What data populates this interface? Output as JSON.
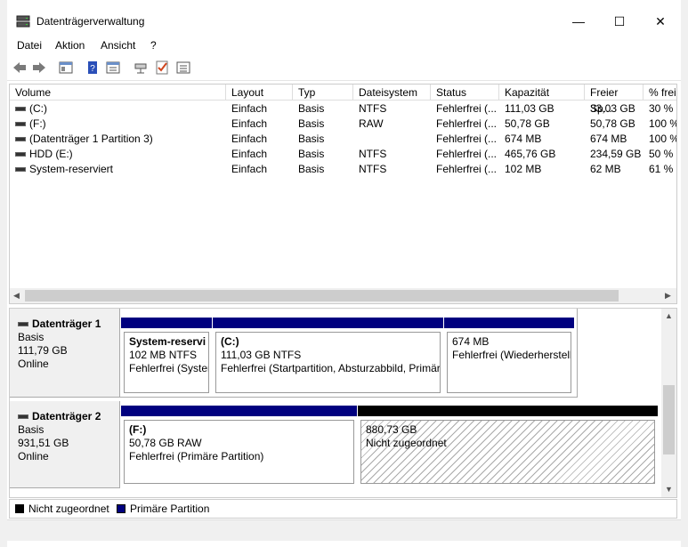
{
  "window": {
    "title": "Datenträgerverwaltung",
    "minimize": "—",
    "maximize": "☐",
    "close": "✕"
  },
  "menu": [
    "Datei",
    "Aktion",
    "Ansicht",
    "?"
  ],
  "table": {
    "columns": [
      "Volume",
      "Layout",
      "Typ",
      "Dateisystem",
      "Status",
      "Kapazität",
      "Freier Sp...",
      "% frei"
    ],
    "rows": [
      {
        "volume": "(C:)",
        "layout": "Einfach",
        "typ": "Basis",
        "fs": "NTFS",
        "status": "Fehlerfrei (...",
        "cap": "111,03 GB",
        "free": "33,03 GB",
        "pct": "30 %"
      },
      {
        "volume": "(F:)",
        "layout": "Einfach",
        "typ": "Basis",
        "fs": "RAW",
        "status": "Fehlerfrei (...",
        "cap": "50,78 GB",
        "free": "50,78 GB",
        "pct": "100 %"
      },
      {
        "volume": "(Datenträger 1 Partition 3)",
        "layout": "Einfach",
        "typ": "Basis",
        "fs": "",
        "status": "Fehlerfrei (...",
        "cap": "674 MB",
        "free": "674 MB",
        "pct": "100 %"
      },
      {
        "volume": "HDD (E:)",
        "layout": "Einfach",
        "typ": "Basis",
        "fs": "NTFS",
        "status": "Fehlerfrei (...",
        "cap": "465,76 GB",
        "free": "234,59 GB",
        "pct": "50 %"
      },
      {
        "volume": "System-reserviert",
        "layout": "Einfach",
        "typ": "Basis",
        "fs": "NTFS",
        "status": "Fehlerfrei (...",
        "cap": "102 MB",
        "free": "62 MB",
        "pct": "61 %"
      }
    ]
  },
  "disks": [
    {
      "title": "Datenträger 1",
      "type": "Basis",
      "size": "111,79 GB",
      "state": "Online",
      "partitions": [
        {
          "name": "System-reservi",
          "line2": "102 MB NTFS",
          "line3": "Fehlerfrei (Syster"
        },
        {
          "name": "(C:)",
          "line2": "111,03 GB NTFS",
          "line3": "Fehlerfrei (Startpartition, Absturzabbild, Primär"
        },
        {
          "name": "",
          "line2": "674 MB",
          "line3": "Fehlerfrei (Wiederherstell"
        }
      ]
    },
    {
      "title": "Datenträger 2",
      "type": "Basis",
      "size": "931,51 GB",
      "state": "Online",
      "partitions": [
        {
          "name": "(F:)",
          "line2": "50,78 GB RAW",
          "line3": "Fehlerfrei (Primäre Partition)"
        },
        {
          "name": "",
          "line2": "880,73 GB",
          "line3": "Nicht zugeordnet"
        }
      ]
    }
  ],
  "legend": {
    "unallocated": "Nicht zugeordnet",
    "primary": "Primäre Partition"
  },
  "colors": {
    "primary": "#00007f",
    "unallocated": "#000000",
    "accent": "#0078d7"
  }
}
